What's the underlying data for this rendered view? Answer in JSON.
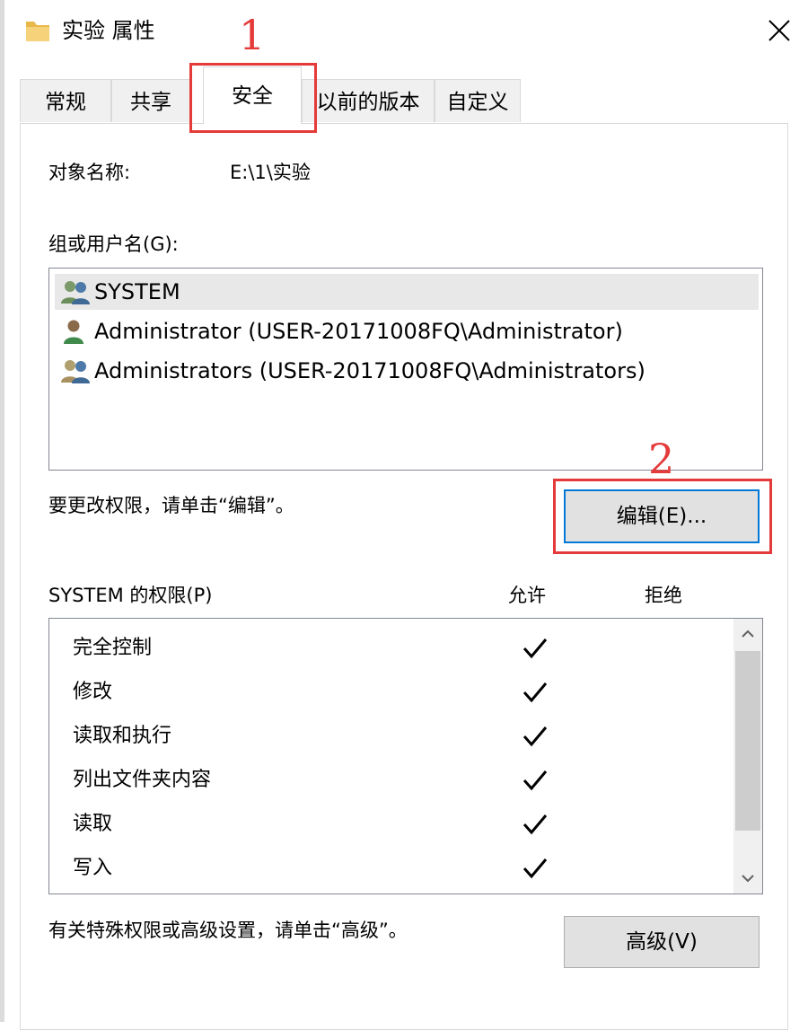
{
  "window": {
    "title": "实验 属性"
  },
  "tabs": [
    {
      "label": "常规"
    },
    {
      "label": "共享"
    },
    {
      "label": "安全"
    },
    {
      "label": "以前的版本"
    },
    {
      "label": "自定义"
    }
  ],
  "active_tab": "安全",
  "object": {
    "label": "对象名称:",
    "value": "E:\\1\\实验"
  },
  "groups": {
    "label": "组或用户名(G):",
    "items": [
      {
        "name": "SYSTEM",
        "icon": "group-icon",
        "selected": true
      },
      {
        "name": "Administrator (USER-20171008FQ\\Administrator)",
        "icon": "user-icon",
        "selected": false
      },
      {
        "name": "Administrators (USER-20171008FQ\\Administrators)",
        "icon": "group-icon",
        "selected": false
      }
    ]
  },
  "edit": {
    "hint": "要更改权限，请单击“编辑”。",
    "button_label": "编辑(E)..."
  },
  "permissions": {
    "label": "SYSTEM 的权限(P)",
    "allow_header": "允许",
    "deny_header": "拒绝",
    "rows": [
      {
        "name": "完全控制",
        "allow": true,
        "deny": false
      },
      {
        "name": "修改",
        "allow": true,
        "deny": false
      },
      {
        "name": "读取和执行",
        "allow": true,
        "deny": false
      },
      {
        "name": "列出文件夹内容",
        "allow": true,
        "deny": false
      },
      {
        "name": "读取",
        "allow": true,
        "deny": false
      },
      {
        "name": "写入",
        "allow": true,
        "deny": false
      }
    ]
  },
  "advanced": {
    "hint": "有关特殊权限或高级设置，请单击“高级”。",
    "button_label": "高级(V)"
  },
  "annotations": [
    {
      "number": "1",
      "target": "安全"
    },
    {
      "number": "2",
      "target": "编辑(E)..."
    }
  ],
  "colors": {
    "annotation": "#e43a3a",
    "focus": "#0078d7",
    "button_bg": "#e1e1e1",
    "selection": "#e8e8e8"
  }
}
